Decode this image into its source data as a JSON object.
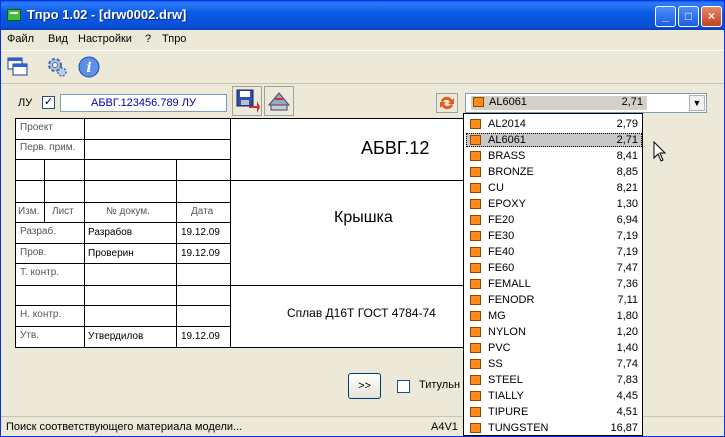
{
  "window": {
    "title": "Тпро 1.02 - [drw0002.drw]"
  },
  "menu": [
    "Файл",
    "Вид",
    "Настройки",
    "?",
    "Тпро"
  ],
  "lu": {
    "label": "ЛУ",
    "checked": true,
    "value": "АБВГ.123456.789 ЛУ"
  },
  "stamp": {
    "rows_left": [
      {
        "label": "Проект"
      },
      {
        "label": "Перв. прим."
      }
    ],
    "header": {
      "izm": "Изм.",
      "list": "Лист",
      "doc": "№ докум.",
      "date": "Дата"
    },
    "roles": [
      {
        "role": "Разраб.",
        "name": "Разрабов",
        "date": "19.12.09"
      },
      {
        "role": "Пров.",
        "name": "Проверин",
        "date": "19.12.09"
      },
      {
        "role": "Т. контр.",
        "name": "",
        "date": ""
      },
      {
        "role": "",
        "name": "",
        "date": ""
      },
      {
        "role": "Н. контр.",
        "name": "",
        "date": ""
      },
      {
        "role": "Утв.",
        "name": "Утвердилов",
        "date": "19.12.09"
      }
    ],
    "designation": "АБВГ.12",
    "part_name": "Крышка",
    "material": "Сплав Д16Т ГОСТ 4784-74"
  },
  "next_label": ">>",
  "title_page_label": "Титульн",
  "status": {
    "text": "Поиск соответствующего материала модели...",
    "format": "A4V1"
  },
  "combo": {
    "name": "AL6061",
    "value": "2,71"
  },
  "materials": [
    {
      "name": "AL2014",
      "value": "2,79"
    },
    {
      "name": "AL6061",
      "value": "2,71",
      "selected": true
    },
    {
      "name": "BRASS",
      "value": "8,41"
    },
    {
      "name": "BRONZE",
      "value": "8,85"
    },
    {
      "name": "CU",
      "value": "8,21"
    },
    {
      "name": "EPOXY",
      "value": "1,30"
    },
    {
      "name": "FE20",
      "value": "6,94"
    },
    {
      "name": "FE30",
      "value": "7,19"
    },
    {
      "name": "FE40",
      "value": "7,19"
    },
    {
      "name": "FE60",
      "value": "7,47"
    },
    {
      "name": "FEMALL",
      "value": "7,36"
    },
    {
      "name": "FENODR",
      "value": "7,11"
    },
    {
      "name": "MG",
      "value": "1,80"
    },
    {
      "name": "NYLON",
      "value": "1,20"
    },
    {
      "name": "PVC",
      "value": "1,40"
    },
    {
      "name": "SS",
      "value": "7,74"
    },
    {
      "name": "STEEL",
      "value": "7,83"
    },
    {
      "name": "TIALLY",
      "value": "4,45"
    },
    {
      "name": "TIPURE",
      "value": "4,51"
    },
    {
      "name": "TUNGSTEN",
      "value": "16,87"
    }
  ],
  "icons": {
    "windows": "windows-icon",
    "settings": "settings-gear-icon",
    "info": "info-icon",
    "save": "save-icon",
    "export": "export-icon",
    "refresh": "refresh-icon",
    "material_swatch": "material-swatch-icon"
  },
  "colors": {
    "titlebar": "#0a5ef5",
    "swatch": "#ff8c1a",
    "lu_text": "#0000c0"
  }
}
